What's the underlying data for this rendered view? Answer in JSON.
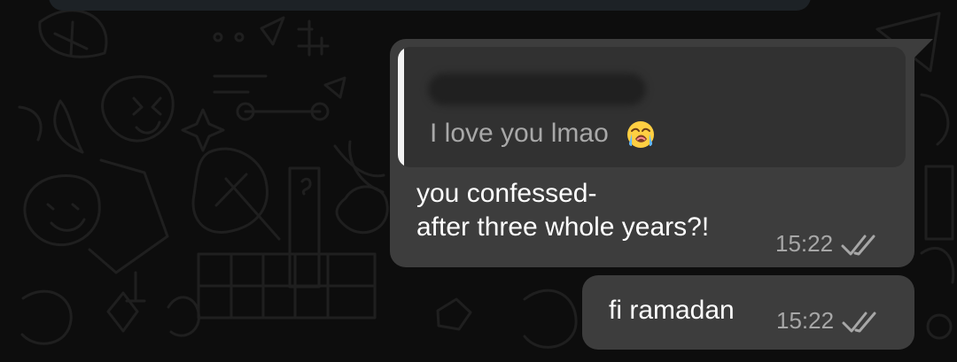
{
  "messages": [
    {
      "quoted_text": "I love you lmao",
      "quoted_emoji": "loudly-crying-face-emoji",
      "text": "you confessed-\nafter three whole years?!",
      "time": "15:22",
      "status_icon": "double-check-icon"
    },
    {
      "text": "fi ramadan",
      "time": "15:22",
      "status_icon": "double-check-icon"
    }
  ],
  "colors": {
    "background": "#0d0d0d",
    "wallpaper_doodles": "#1f1f1f",
    "bubble": "#3d3d3d",
    "quote_background": "#313131",
    "quote_bar": "#f2f2f2",
    "muted_text": "#a7a7a7"
  }
}
